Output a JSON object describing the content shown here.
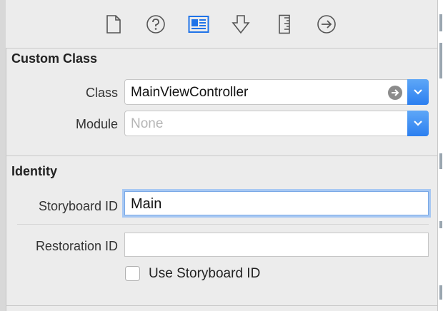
{
  "toolbar": {
    "tabs": [
      {
        "name": "file-inspector",
        "icon": "document-icon"
      },
      {
        "name": "quick-help",
        "icon": "help-icon"
      },
      {
        "name": "identity-inspector",
        "icon": "identity-card-icon",
        "selected": true
      },
      {
        "name": "attributes-inspector",
        "icon": "arrow-down-shield-icon"
      },
      {
        "name": "size-inspector",
        "icon": "ruler-icon"
      },
      {
        "name": "connections-inspector",
        "icon": "circle-arrow-right-icon"
      }
    ]
  },
  "custom_class": {
    "title": "Custom Class",
    "class_label": "Class",
    "class_value": "MainViewController",
    "module_label": "Module",
    "module_placeholder": "None"
  },
  "identity": {
    "title": "Identity",
    "storyboard_id_label": "Storyboard ID",
    "storyboard_id_value": "Main",
    "restoration_id_label": "Restoration ID",
    "restoration_id_value": "",
    "use_storyboard_id_label": "Use Storyboard ID",
    "use_storyboard_id_checked": false
  },
  "colors": {
    "accent": "#2c7ff0",
    "selected_icon": "#1f73e8",
    "focus_ring": "#a7c8f3"
  }
}
